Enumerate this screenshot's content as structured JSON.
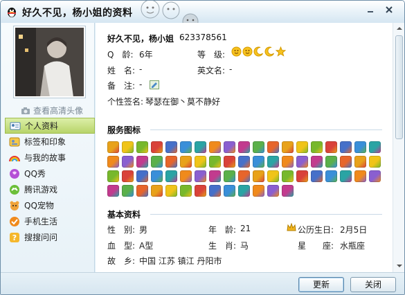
{
  "window": {
    "title": "好久不见，杨小姐的资料"
  },
  "left": {
    "hd_avatar_label": "查看高清头像",
    "nav": [
      {
        "label": "个人资料",
        "active": true
      },
      {
        "label": "标签和印象",
        "active": false
      },
      {
        "label": "与我的故事",
        "active": false
      },
      {
        "label": "QQ秀",
        "active": false
      },
      {
        "label": "腾讯游戏",
        "active": false
      },
      {
        "label": "QQ宠物",
        "active": false
      },
      {
        "label": "手机生活",
        "active": false
      },
      {
        "label": "搜搜问问",
        "active": false
      }
    ]
  },
  "profile": {
    "nickname": "好久不见，杨小姐",
    "qq_number": "623378561",
    "qage_label": "Q　龄:",
    "qage_value": "6年",
    "level_label": "等　级:",
    "level_icons": [
      "sun",
      "sun",
      "moon",
      "moon",
      "star"
    ],
    "name_label": "姓　名:",
    "name_value": "-",
    "english_name_label": "英文名:",
    "english_name_value": "-",
    "remark_label": "备　注:",
    "remark_value": "-",
    "signature_label": "个性签名:",
    "signature_value": "琴瑟在御丶莫不静好"
  },
  "service_icons": {
    "title": "服务图标",
    "count": 70
  },
  "basic_info": {
    "title": "基本资料",
    "gender_label": "性　别:",
    "gender_value": "男",
    "age_label": "年　龄:",
    "age_value": "21",
    "birthday_label": "公历生日:",
    "birthday_value": "2月5日",
    "blood_label": "血　型:",
    "blood_value": "A型",
    "zodiac_label": "生　肖:",
    "zodiac_value": "马",
    "constellation_label": "星　　座:",
    "constellation_value": "水瓶座",
    "hometown_label": "故　乡:",
    "hometown_value": "中国 江苏 镇江 丹阳市"
  },
  "buttons": {
    "update": "更新",
    "close": "关闭"
  },
  "colors": {
    "nav_active": "#b8d46a",
    "title_bar": "#d5e6f2",
    "window_border": "#6f8fa8"
  }
}
